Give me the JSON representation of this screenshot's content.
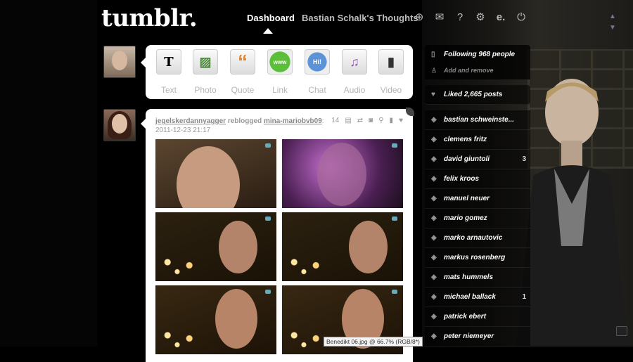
{
  "header": {
    "logo": "tumblr.",
    "nav": [
      {
        "label": "Dashboard"
      },
      {
        "label": "Bastian Schalk's Thoughts"
      }
    ],
    "icons": [
      "add-post-icon",
      "mail-icon",
      "help-icon",
      "gear-icon",
      "edit-e-icon",
      "power-icon"
    ]
  },
  "composer": {
    "types": [
      {
        "label": "Text",
        "icon": "text-icon",
        "glyph": "T"
      },
      {
        "label": "Photo",
        "icon": "photo-icon",
        "glyph": "▨"
      },
      {
        "label": "Quote",
        "icon": "quote-icon",
        "glyph": "“"
      },
      {
        "label": "Link",
        "icon": "link-icon",
        "glyph": "www"
      },
      {
        "label": "Chat",
        "icon": "chat-icon",
        "glyph": "Hi!"
      },
      {
        "label": "Audio",
        "icon": "audio-icon",
        "glyph": "♫"
      },
      {
        "label": "Video",
        "icon": "video-icon",
        "glyph": "▮"
      }
    ]
  },
  "post": {
    "author": "jegelskerdannyagger",
    "action": "reblogged",
    "source": "mina-mariobvb09",
    "timestamp": "2011-12-23 21:17",
    "notes": "14"
  },
  "sidebar": {
    "following": "Following 968 people",
    "add_remove": "Add and remove",
    "liked": "Liked 2,665 posts",
    "tags": [
      {
        "label": "bastian schweinste...",
        "count": ""
      },
      {
        "label": "clemens fritz",
        "count": ""
      },
      {
        "label": "david giuntoli",
        "count": "3"
      },
      {
        "label": "felix kroos",
        "count": ""
      },
      {
        "label": "manuel neuer",
        "count": ""
      },
      {
        "label": "mario gomez",
        "count": ""
      },
      {
        "label": "marko arnautovic",
        "count": ""
      },
      {
        "label": "markus rosenberg",
        "count": ""
      },
      {
        "label": "mats hummels",
        "count": ""
      },
      {
        "label": "michael ballack",
        "count": "1"
      },
      {
        "label": "patrick ebert",
        "count": ""
      },
      {
        "label": "peter niemeyer",
        "count": ""
      }
    ]
  },
  "tooltip": "Benedikt 06.jpg @ 66.7% (RGB/8*)",
  "colors": {
    "background": "#000000",
    "card": "#ffffff",
    "label_gray": "#b5b5b5"
  }
}
